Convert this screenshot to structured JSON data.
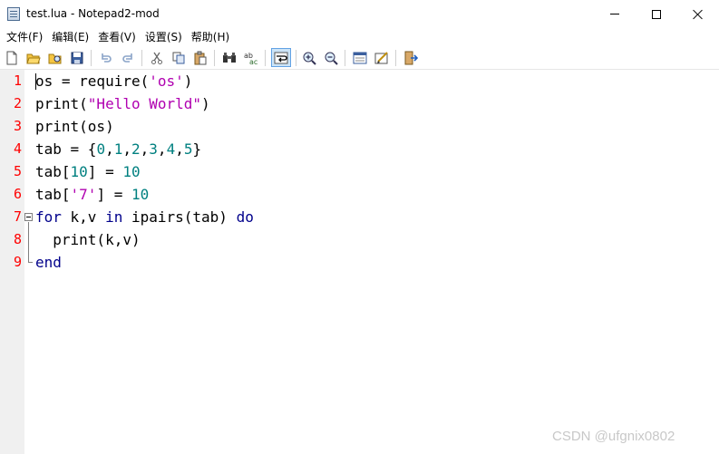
{
  "window": {
    "title": "test.lua - Notepad2-mod",
    "minimize_icon": "minimize-icon",
    "maximize_icon": "maximize-icon",
    "close_icon": "close-icon"
  },
  "menu": [
    {
      "label": "文件(F)"
    },
    {
      "label": "编辑(E)"
    },
    {
      "label": "查看(V)"
    },
    {
      "label": "设置(S)"
    },
    {
      "label": "帮助(H)"
    }
  ],
  "toolbar": {
    "buttons": [
      {
        "icon": "new-file-icon"
      },
      {
        "icon": "open-folder-icon"
      },
      {
        "icon": "browse-icon"
      },
      {
        "icon": "save-icon"
      },
      {
        "icon": "undo-icon"
      },
      {
        "icon": "redo-icon"
      },
      {
        "icon": "cut-icon"
      },
      {
        "icon": "copy-icon"
      },
      {
        "icon": "paste-icon"
      },
      {
        "icon": "find-icon"
      },
      {
        "icon": "replace-icon"
      },
      {
        "icon": "word-wrap-icon",
        "active": true
      },
      {
        "icon": "zoom-in-icon"
      },
      {
        "icon": "zoom-out-icon"
      },
      {
        "icon": "scheme-icon"
      },
      {
        "icon": "customize-scheme-icon"
      },
      {
        "icon": "exit-icon"
      }
    ]
  },
  "editor": {
    "line_numbers": [
      "1",
      "2",
      "3",
      "4",
      "5",
      "6",
      "7",
      "8",
      "9"
    ],
    "lines": [
      [
        {
          "t": "os = require(",
          "c": "plain"
        },
        {
          "t": "'os'",
          "c": "str"
        },
        {
          "t": ")",
          "c": "plain"
        }
      ],
      [
        {
          "t": "print(",
          "c": "plain"
        },
        {
          "t": "\"Hello World\"",
          "c": "str"
        },
        {
          "t": ")",
          "c": "plain"
        }
      ],
      [
        {
          "t": "print(os)",
          "c": "plain"
        }
      ],
      [
        {
          "t": "tab = {",
          "c": "plain"
        },
        {
          "t": "0",
          "c": "num"
        },
        {
          "t": ",",
          "c": "plain"
        },
        {
          "t": "1",
          "c": "num"
        },
        {
          "t": ",",
          "c": "plain"
        },
        {
          "t": "2",
          "c": "num"
        },
        {
          "t": ",",
          "c": "plain"
        },
        {
          "t": "3",
          "c": "num"
        },
        {
          "t": ",",
          "c": "plain"
        },
        {
          "t": "4",
          "c": "num"
        },
        {
          "t": ",",
          "c": "plain"
        },
        {
          "t": "5",
          "c": "num"
        },
        {
          "t": "}",
          "c": "plain"
        }
      ],
      [
        {
          "t": "tab[",
          "c": "plain"
        },
        {
          "t": "10",
          "c": "num"
        },
        {
          "t": "] = ",
          "c": "plain"
        },
        {
          "t": "10",
          "c": "num"
        }
      ],
      [
        {
          "t": "tab[",
          "c": "plain"
        },
        {
          "t": "'7'",
          "c": "str"
        },
        {
          "t": "] = ",
          "c": "plain"
        },
        {
          "t": "10",
          "c": "num"
        }
      ],
      [
        {
          "t": "for",
          "c": "kw"
        },
        {
          "t": " k,v ",
          "c": "plain"
        },
        {
          "t": "in",
          "c": "kw"
        },
        {
          "t": " ipairs(tab) ",
          "c": "plain"
        },
        {
          "t": "do",
          "c": "kw"
        }
      ],
      [
        {
          "t": "  print(k,v)",
          "c": "plain"
        }
      ],
      [
        {
          "t": "end",
          "c": "kw"
        }
      ]
    ],
    "colors": {
      "line_number": "#ff0000",
      "string": "#b000b0",
      "number": "#008080",
      "keyword": "#00008b"
    }
  },
  "watermark": "CSDN @ufgnix0802"
}
